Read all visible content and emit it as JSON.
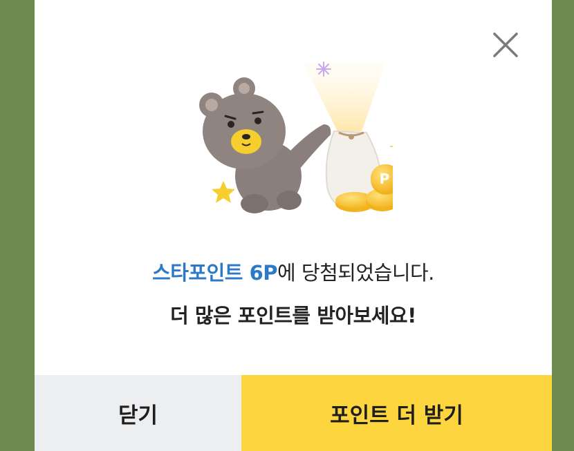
{
  "dialog": {
    "message_highlight": "스타포인트 6P",
    "message_rest": "에 당첨되었습니다.",
    "message_sub": "더 많은 포인트를 받아보세요!",
    "close_button_label": "닫기",
    "more_points_button_label": "포인트 더 받기",
    "coin_label": "P"
  },
  "colors": {
    "backdrop": "#70894f",
    "highlight_text": "#2c79c8",
    "primary_button": "#fcd53f",
    "secondary_button": "#eceef0",
    "close_icon": "#7a7a7a"
  },
  "icons": {
    "close": "close-icon",
    "illustration": "bear-with-money-bag-illustration"
  }
}
